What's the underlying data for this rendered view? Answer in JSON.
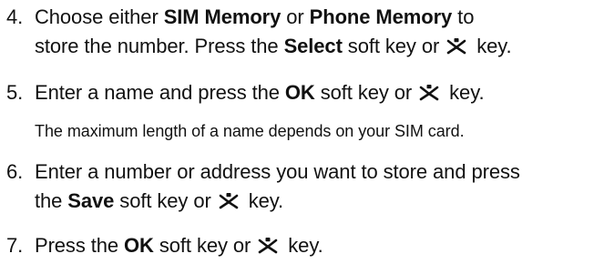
{
  "steps": [
    {
      "number": "4.",
      "line1_pre": "Choose either ",
      "line1_b1": "SIM Memory",
      "line1_mid": " or ",
      "line1_b2": "Phone Memory",
      "line1_post": " to",
      "line2_pre": "store the number. Press the ",
      "line2_b": "Select",
      "line2_mid": " soft key or ",
      "line2_post": " key."
    },
    {
      "number": "5.",
      "pre": "Enter a name and press the ",
      "b": "OK",
      "mid": " soft key or ",
      "post": " key.",
      "note": "The maximum length of a name depends on your SIM card."
    },
    {
      "number": "6.",
      "line1": "Enter a number or address you want to store and press",
      "line2_pre": "the ",
      "line2_b": "Save",
      "line2_mid": " soft key or ",
      "line2_post": " key."
    },
    {
      "number": "7.",
      "pre": "Press the ",
      "b": "OK",
      "mid": " soft key or ",
      "post": " key."
    }
  ],
  "icon": "navigation-key-icon",
  "colors": {
    "text": "#111111",
    "background": "#ffffff"
  }
}
